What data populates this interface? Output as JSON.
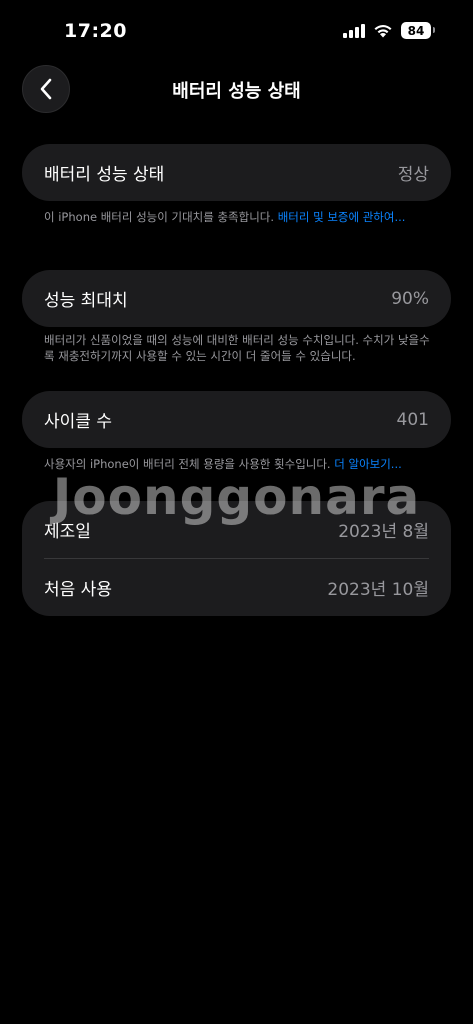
{
  "status_bar": {
    "time": "17:20",
    "battery_level": "84"
  },
  "header": {
    "title": "배터리 성능 상태",
    "back_icon": "chevron-left-icon"
  },
  "health": {
    "label": "배터리 성능 상태",
    "value": "정상",
    "note_text": "이 iPhone 배터리 성능이 기대치를 충족합니다. ",
    "note_link": "배터리 및 보증에 관하여..."
  },
  "max_capacity": {
    "label": "성능 최대치",
    "value": "90%",
    "note_text": "배터리가 신품이었을 때의 성능에 대비한 배터리 성능 수치입니다. 수치가 낮을수록 재충전하기까지 사용할 수 있는 시간이 더 줄어들 수 있습니다."
  },
  "cycle_count": {
    "label": "사이클 수",
    "value": "401",
    "note_text": "사용자의 iPhone이 배터리 전체 용량을 사용한 횟수입니다. ",
    "note_link": "더 알아보기..."
  },
  "dates": {
    "manufacture_label": "제조일",
    "manufacture_value": "2023년 8월",
    "first_use_label": "처음 사용",
    "first_use_value": "2023년 10월"
  },
  "watermark": "Joonggonara",
  "colors": {
    "background": "#000000",
    "card": "#1c1c1e",
    "link": "#0a84ff",
    "secondary_text": "#98989d"
  }
}
